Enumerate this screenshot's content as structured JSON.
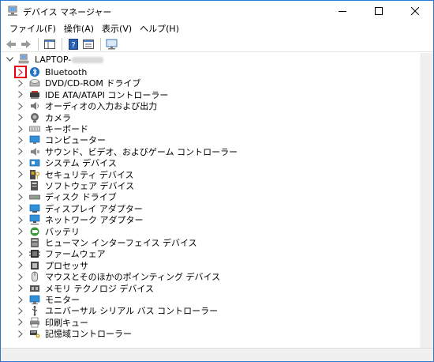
{
  "window": {
    "title": "デバイス マネージャー"
  },
  "menu": [
    "ファイル(F)",
    "操作(A)",
    "表示(V)",
    "ヘルプ(H)"
  ],
  "tree": {
    "root": {
      "label": "LAPTOP-"
    },
    "items": [
      {
        "label": "Bluetooth",
        "icon": "bluetooth-icon",
        "highlighted": true
      },
      {
        "label": "DVD/CD-ROM ドライブ",
        "icon": "dvd-drive-icon"
      },
      {
        "label": "IDE ATA/ATAPI コントローラー",
        "icon": "ide-controller-icon"
      },
      {
        "label": "オーディオの入力および出力",
        "icon": "speaker-icon"
      },
      {
        "label": "カメラ",
        "icon": "camera-icon"
      },
      {
        "label": "キーボード",
        "icon": "keyboard-icon"
      },
      {
        "label": "コンピューター",
        "icon": "computer-icon"
      },
      {
        "label": "サウンド、ビデオ、およびゲーム コントローラー",
        "icon": "sound-icon"
      },
      {
        "label": "システム デバイス",
        "icon": "system-device-icon"
      },
      {
        "label": "セキュリティ デバイス",
        "icon": "security-device-icon"
      },
      {
        "label": "ソフトウェア デバイス",
        "icon": "software-device-icon"
      },
      {
        "label": "ディスク ドライブ",
        "icon": "disk-drive-icon"
      },
      {
        "label": "ディスプレイ アダプター",
        "icon": "display-adapter-icon"
      },
      {
        "label": "ネットワーク アダプター",
        "icon": "network-adapter-icon"
      },
      {
        "label": "バッテリ",
        "icon": "battery-icon"
      },
      {
        "label": "ヒューマン インターフェイス デバイス",
        "icon": "hid-icon"
      },
      {
        "label": "ファームウェア",
        "icon": "firmware-icon"
      },
      {
        "label": "プロセッサ",
        "icon": "processor-icon"
      },
      {
        "label": "マウスとそのほかのポインティング デバイス",
        "icon": "mouse-icon"
      },
      {
        "label": "メモリ テクノロジ デバイス",
        "icon": "memory-icon"
      },
      {
        "label": "モニター",
        "icon": "monitor-icon"
      },
      {
        "label": "ユニバーサル シリアル バス コントローラー",
        "icon": "usb-icon"
      },
      {
        "label": "印刷キュー",
        "icon": "printer-icon"
      },
      {
        "label": "記憶域コントローラー",
        "icon": "storage-controller-icon"
      }
    ]
  },
  "colors": {
    "accent": "#2b78d4",
    "highlight": "#e60012",
    "icon_blue": "#1f6fc5"
  }
}
